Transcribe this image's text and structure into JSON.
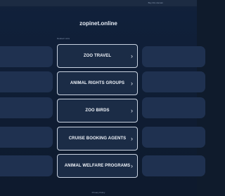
{
  "topbar": {
    "text": "Buy this domain"
  },
  "site": {
    "title": "zopinet.online"
  },
  "section": {
    "label": "Related Links"
  },
  "links": [
    {
      "label": "ZOO TRAVEL",
      "icon": "chevron-right-icon"
    },
    {
      "label": "ANIMAL RIGHTS GROUPS",
      "icon": "chevron-right-icon"
    },
    {
      "label": "ZOO BIRDS",
      "icon": "chevron-right-icon"
    },
    {
      "label": "CRUISE BOOKING AGENTS",
      "icon": "chevron-right-icon"
    },
    {
      "label": "ANIMAL WELFARE PROGRAMS",
      "icon": "chevron-right-icon"
    }
  ],
  "footer": {
    "text": "Privacy Policy"
  },
  "colors": {
    "background": "#0f1b2c",
    "card": "#1b2c46",
    "card_border": "#c9d3e1",
    "side_panel": "#1f3150"
  }
}
